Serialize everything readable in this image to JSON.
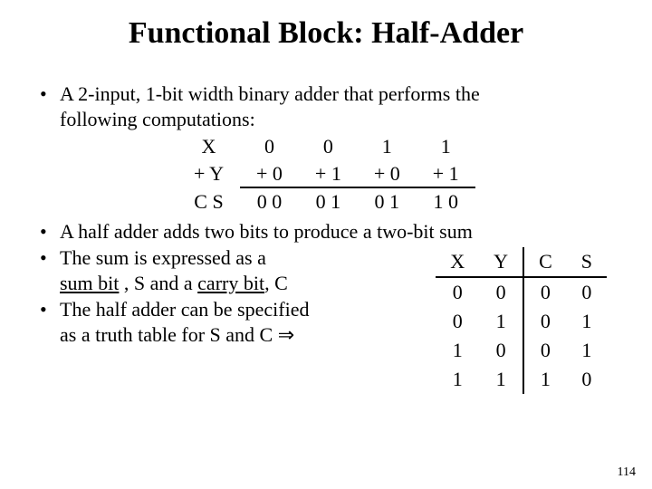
{
  "title": "Functional Block: Half-Adder",
  "bullet1_a": "A 2-input, 1-bit width binary adder that performs the",
  "bullet1_b": "following computations:",
  "add": {
    "r1": {
      "label": "X",
      "c1": "0",
      "c2": "0",
      "c3": "1",
      "c4": "1"
    },
    "r2": {
      "label": "+ Y",
      "c1": "+ 0",
      "c2": "+ 1",
      "c3": "+ 0",
      "c4": "+ 1"
    },
    "r3": {
      "label": "C S",
      "c1": "0 0",
      "c2": "0 1",
      "c3": "0 1",
      "c4": "1 0"
    }
  },
  "bullet2": "A half adder adds two bits to produce a two-bit sum",
  "bullet3_a": "The sum is expressed as a",
  "bullet3_b1": "sum bit",
  "bullet3_b2": " , S and a ",
  "bullet3_b3": "carry bit",
  "bullet3_b4": ", C",
  "bullet4_a": "The half adder can be specified",
  "bullet4_b": "as a truth table for S and C ",
  "arrow": "⇒",
  "truth": {
    "h": {
      "x": "X",
      "y": "Y",
      "c": "C",
      "s": "S"
    },
    "r0": {
      "x": "0",
      "y": "0",
      "c": "0",
      "s": "0"
    },
    "r1": {
      "x": "0",
      "y": "1",
      "c": "0",
      "s": "1"
    },
    "r2": {
      "x": "1",
      "y": "0",
      "c": "0",
      "s": "1"
    },
    "r3": {
      "x": "1",
      "y": "1",
      "c": "1",
      "s": "0"
    }
  },
  "page": "114"
}
